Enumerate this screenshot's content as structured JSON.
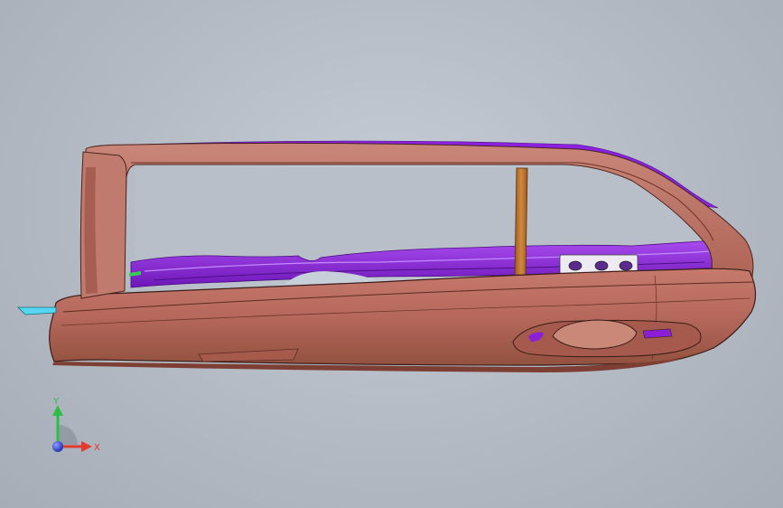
{
  "viewport": {
    "background": "#b9c0ca"
  },
  "model": {
    "body_color": "#b86a5e",
    "body_dark": "#8e4a40",
    "edge_color": "#3a1d18",
    "inner_color": "#8a1fd6",
    "inner_light": "#a450ee",
    "pillar_color": "#c07a2f",
    "bracket_color": "#ece8f0",
    "accent_cyan": "#56d6f0"
  },
  "triad": {
    "x_label": "X",
    "y_label": "Y",
    "x_color": "#e23b2e",
    "y_color": "#2fbd4a",
    "z_color": "#2c3fe0"
  }
}
